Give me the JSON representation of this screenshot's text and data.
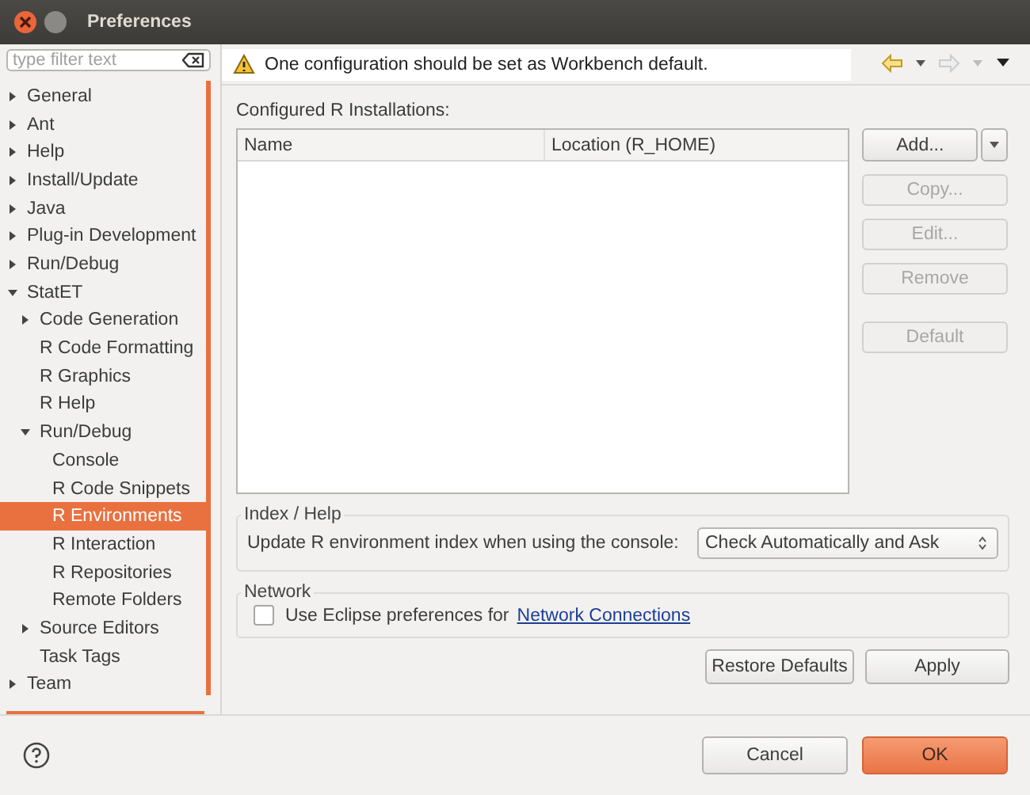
{
  "window": {
    "title": "Preferences"
  },
  "filter": {
    "placeholder": "type filter text"
  },
  "tree": [
    {
      "label": "General",
      "expanded": false,
      "selected": false
    },
    {
      "label": "Ant",
      "expanded": false,
      "selected": false
    },
    {
      "label": "Help",
      "expanded": false,
      "selected": false
    },
    {
      "label": "Install/Update",
      "expanded": false,
      "selected": false
    },
    {
      "label": "Java",
      "expanded": false,
      "selected": false
    },
    {
      "label": "Plug-in Development",
      "expanded": false,
      "selected": false
    },
    {
      "label": "Run/Debug",
      "expanded": false,
      "selected": false
    },
    {
      "label": "StatET",
      "expanded": true,
      "selected": false,
      "children": [
        {
          "label": "Code Generation",
          "expanded": false,
          "selected": false
        },
        {
          "label": "R Code Formatting",
          "selected": false
        },
        {
          "label": "R Graphics",
          "selected": false
        },
        {
          "label": "R Help",
          "selected": false
        },
        {
          "label": "Run/Debug",
          "expanded": true,
          "selected": false,
          "children": [
            {
              "label": "Console",
              "selected": false
            },
            {
              "label": "R Code Snippets",
              "selected": false
            },
            {
              "label": "R Environments",
              "selected": true
            },
            {
              "label": "R Interaction",
              "selected": false
            },
            {
              "label": "R Repositories",
              "selected": false
            },
            {
              "label": "Remote Folders",
              "selected": false
            }
          ]
        },
        {
          "label": "Source Editors",
          "expanded": false,
          "selected": false
        },
        {
          "label": "Task Tags",
          "selected": false
        }
      ]
    },
    {
      "label": "Team",
      "expanded": false,
      "selected": false
    }
  ],
  "message": "One configuration should be set as Workbench default.",
  "installations": {
    "label": "Configured R Installations:",
    "columns": [
      "Name",
      "Location (R_HOME)"
    ],
    "buttons": [
      {
        "label": "Add...",
        "disabled": false
      },
      {
        "label": "Copy...",
        "disabled": true
      },
      {
        "label": "Edit...",
        "disabled": true
      },
      {
        "label": "Remove",
        "disabled": true
      },
      {
        "label": "Default",
        "disabled": true
      }
    ]
  },
  "index_help": {
    "title": "Index / Help",
    "label": "Update R environment index when using the console:",
    "value": "Check Automatically and Ask"
  },
  "network": {
    "title": "Network",
    "checkbox_label": "Use Eclipse preferences for",
    "checked": false,
    "link": "Network Connections"
  },
  "page_buttons": [
    "Restore Defaults",
    "Apply"
  ],
  "dialog_buttons": [
    "Cancel",
    "OK"
  ]
}
